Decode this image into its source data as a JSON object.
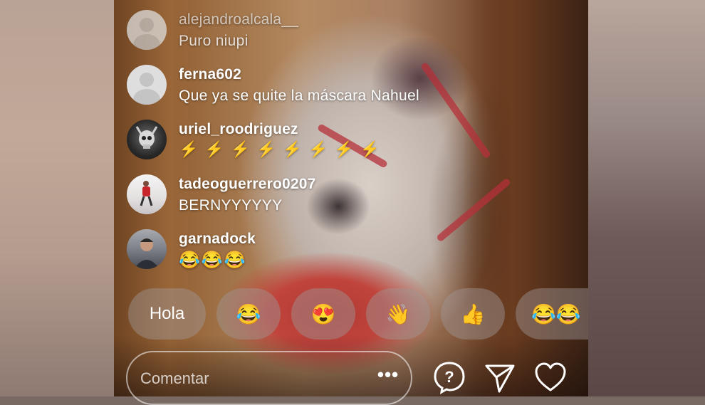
{
  "comments": [
    {
      "username": "alejandroalcala__",
      "text": "Puro niupi",
      "avatar": "default-avatar-icon",
      "faded": true
    },
    {
      "username": "ferna602",
      "text": "Que ya se quite la máscara Nahuel",
      "avatar": "default-avatar-icon"
    },
    {
      "username": "uriel_roodriguez",
      "text": "⚡⚡⚡⚡⚡⚡⚡⚡",
      "avatar": "skull-avatar"
    },
    {
      "username": "tadeoguerrero0207",
      "text": "BERNYYYYYY",
      "avatar": "player-avatar"
    },
    {
      "username": "garnadock",
      "text": "😂😂😂",
      "avatar": "person-avatar"
    }
  ],
  "quick_replies": [
    "Hola",
    "😂",
    "😍",
    "👋",
    "👍",
    "😂😂"
  ],
  "comment_bar": {
    "placeholder": "Comentar",
    "more_label": "•••"
  },
  "icons": {
    "question": "question-icon",
    "share": "send-icon",
    "like": "heart-icon"
  },
  "colors": {
    "bolt": "#ffd21e",
    "text": "#ffffff"
  }
}
